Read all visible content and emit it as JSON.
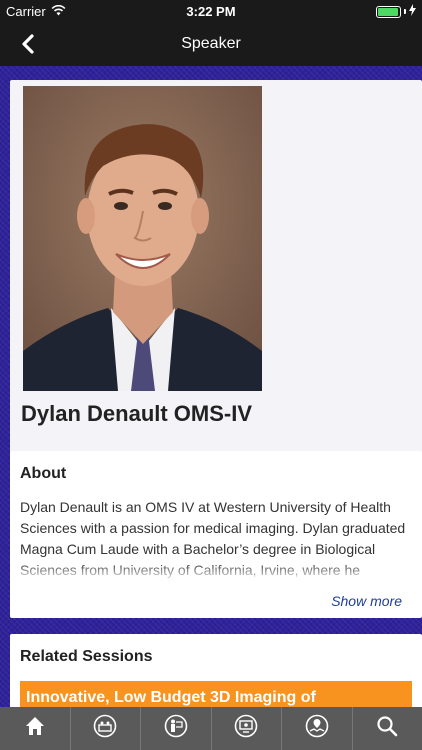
{
  "status": {
    "carrier": "Carrier",
    "time": "3:22 PM",
    "battery_level": 0.95
  },
  "nav": {
    "title": "Speaker",
    "back_icon": "chevron-left-icon"
  },
  "speaker": {
    "name": "Dylan Denault OMS-IV"
  },
  "about": {
    "heading": "About",
    "text": "Dylan Denault is an OMS IV at Western University of Health Sciences with a passion for medical imaging. Dylan graduated Magna Cum Laude with a Bachelor’s degree in Biological Sciences from University of California, Irvine, where he researched the retrotransposon life cycle in yeast.",
    "show_more": "Show more"
  },
  "sessions": {
    "heading": "Related Sessions",
    "items": [
      {
        "title": "Innovative, Low Budget 3D Imaging of"
      }
    ]
  },
  "tabs": [
    {
      "icon": "home-icon"
    },
    {
      "icon": "exhibit-icon"
    },
    {
      "icon": "presenter-icon"
    },
    {
      "icon": "monitor-icon"
    },
    {
      "icon": "map-icon"
    },
    {
      "icon": "search-icon"
    }
  ],
  "colors": {
    "accent": "#f7931e",
    "background": "#2f229a",
    "bar": "#1a1a1a",
    "tab_bar": "#5a5a5a",
    "link": "#1f3f8f",
    "battery": "#4cd964"
  }
}
